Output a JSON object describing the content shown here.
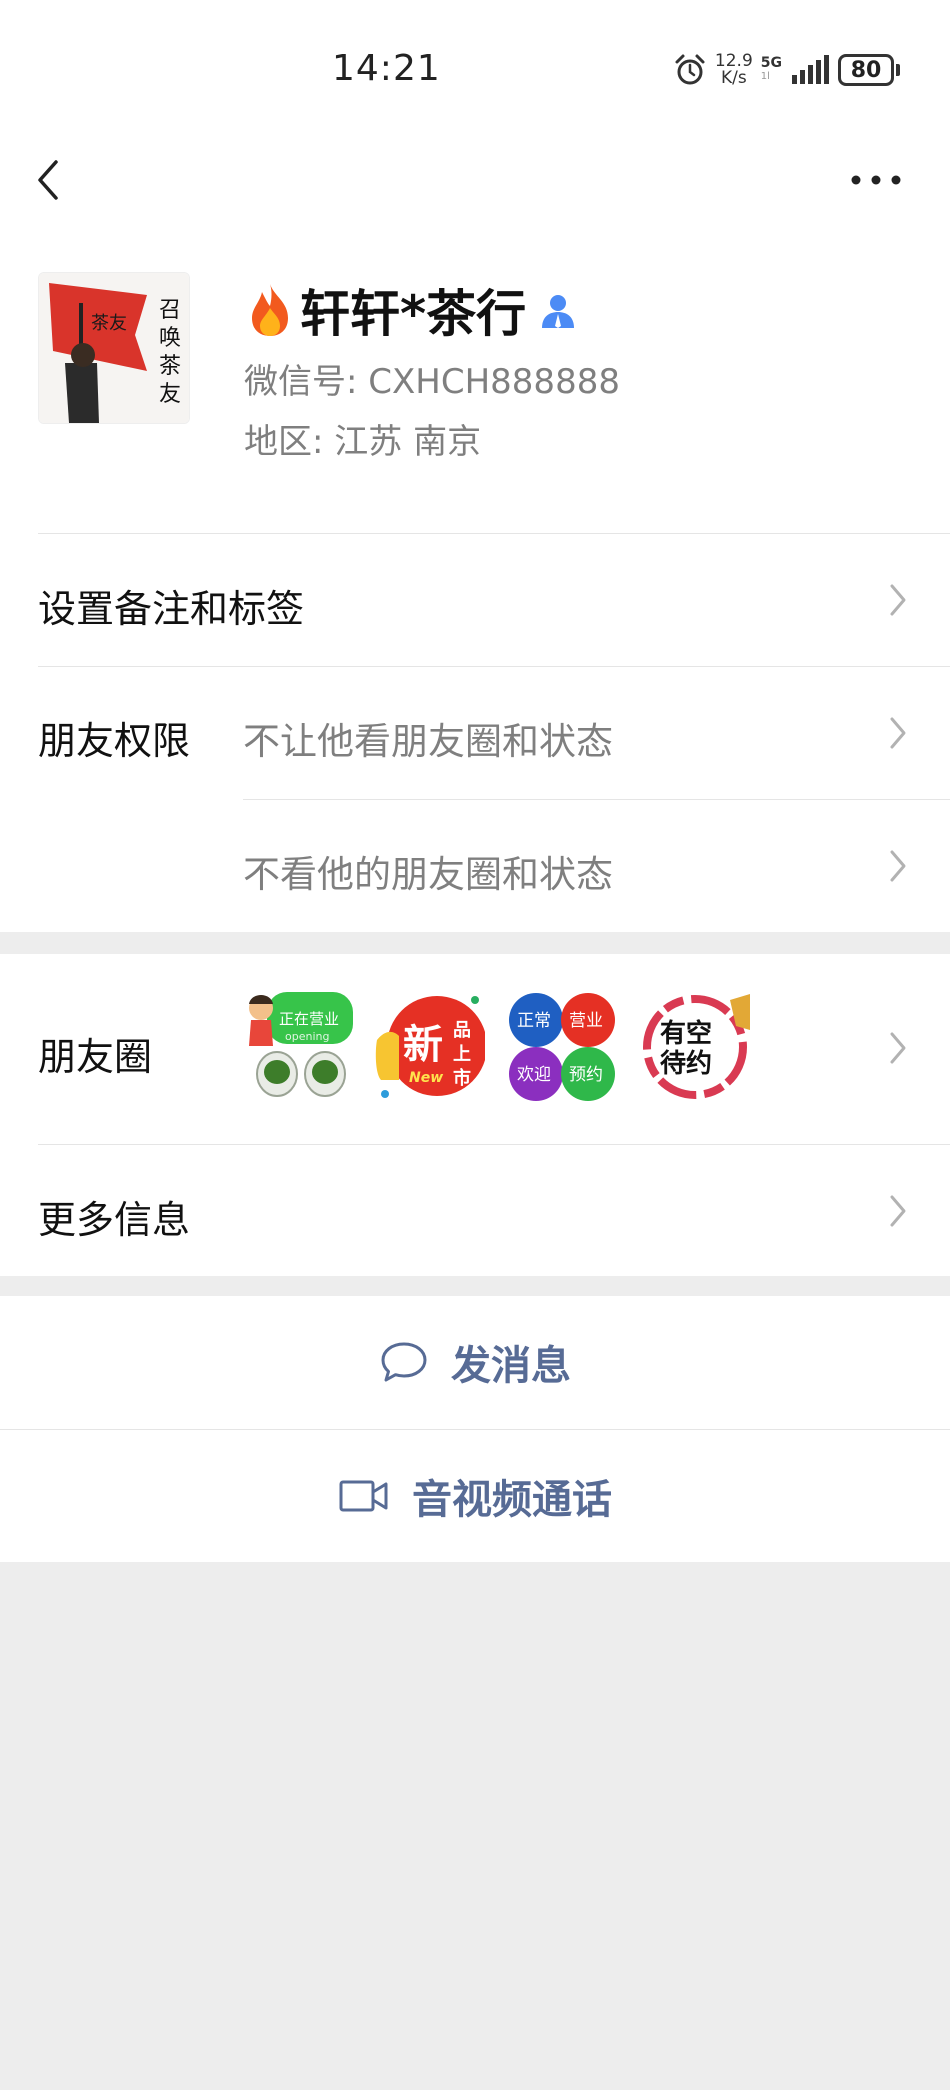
{
  "status_bar": {
    "time": "14:21",
    "net_speed_value": "12.9",
    "net_speed_unit": "K/s",
    "network_type": "5G",
    "network_sub": "1l",
    "battery_level": "80",
    "icons": [
      "alarm-icon",
      "signal-icon",
      "battery-icon"
    ]
  },
  "nav": {
    "back_icon": "chevron-left-icon",
    "more_icon": "more-dots-icon"
  },
  "profile": {
    "name": "轩轩*茶行",
    "name_prefix_icon": "fire-icon",
    "name_suffix_icon": "person-icon",
    "wechat_id": "微信号:  CXHCH888888",
    "region": "地区:  江苏  南京",
    "avatar_flag_text": "茶友",
    "avatar_side_text": [
      "召",
      "唤",
      "茶",
      "友"
    ]
  },
  "settings": {
    "remark_label": "设置备注和标签",
    "permissions_label": "朋友权限",
    "permission_1": "不让他看朋友圈和状态",
    "permission_2": "不看他的朋友圈和状态"
  },
  "moments": {
    "label": "朋友圈",
    "thumbnails": [
      {
        "name": "moment-open-business",
        "text": [
          "正在营业",
          "opening"
        ]
      },
      {
        "name": "moment-new-product",
        "text": [
          "新",
          "品",
          "上",
          "市",
          "New"
        ]
      },
      {
        "name": "moment-business-welcome",
        "text": [
          "正常",
          "营业",
          "欢迎",
          "预约"
        ]
      },
      {
        "name": "moment-available",
        "text": [
          "有空",
          "待约"
        ]
      }
    ]
  },
  "more_info": {
    "label": "更多信息"
  },
  "actions": {
    "message_label": "发消息",
    "message_icon": "chat-bubble-icon",
    "call_label": "音视频通话",
    "call_icon": "video-camera-icon"
  },
  "colors": {
    "background": "#ededed",
    "card": "#ffffff",
    "link_blue": "#576b95",
    "secondary_text": "#7f7f7f"
  }
}
